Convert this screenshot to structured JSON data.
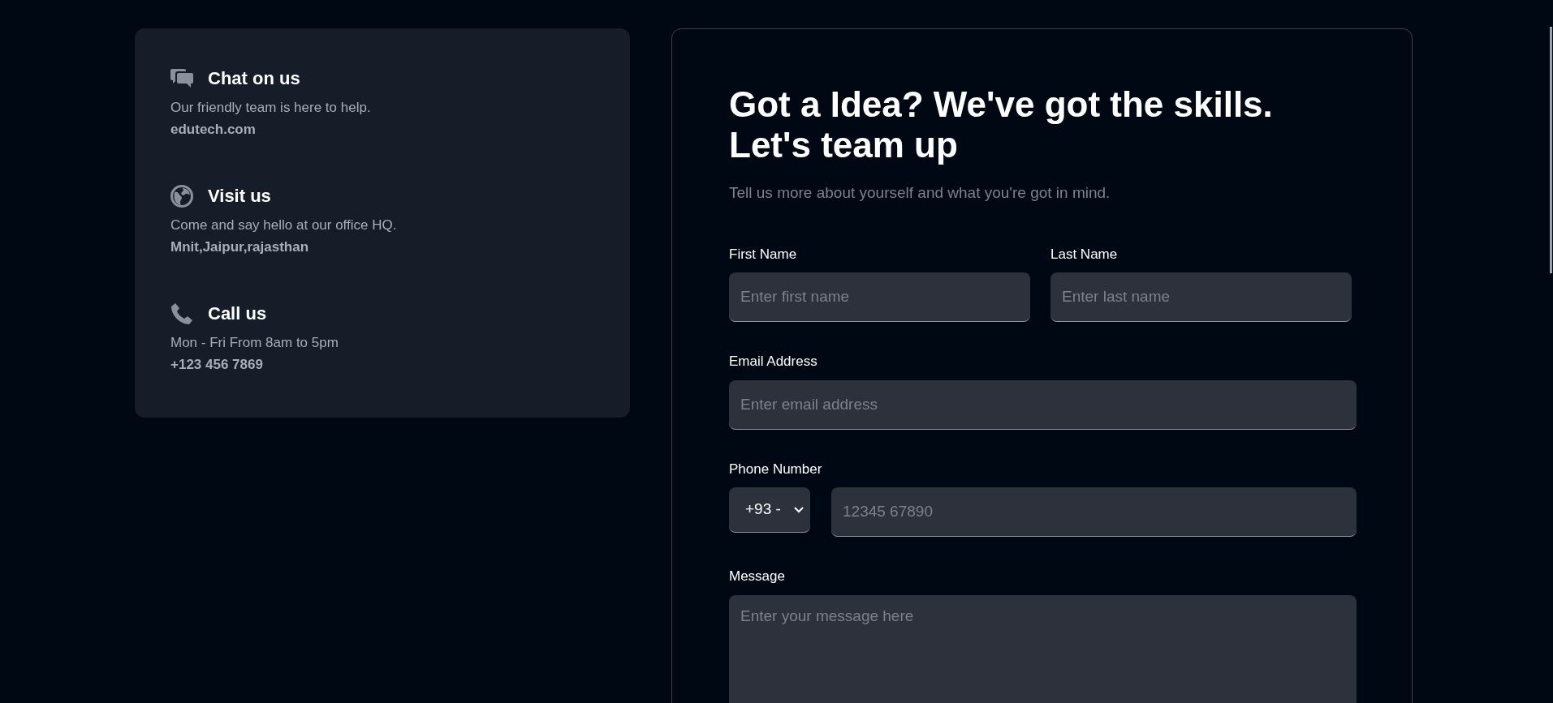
{
  "contacts": [
    {
      "kind": "chat",
      "title": "Chat on us",
      "description": "Our friendly team is here to help.",
      "detail": "edutech.com"
    },
    {
      "kind": "globe",
      "title": "Visit us",
      "description": "Come and say hello at our office HQ.",
      "detail": "Mnit,Jaipur,rajasthan"
    },
    {
      "kind": "phone",
      "title": "Call us",
      "description": "Mon - Fri From 8am to 5pm",
      "detail": "+123 456 7869"
    }
  ],
  "form": {
    "heading_lines": [
      "Got a Idea? We've got the skills.",
      "Let's team up"
    ],
    "subtitle": "Tell us more about yourself and what you're got in mind.",
    "first_name": {
      "label": "First Name",
      "placeholder": "Enter first name"
    },
    "last_name": {
      "label": "Last Name",
      "placeholder": "Enter last name"
    },
    "email": {
      "label": "Email Address",
      "placeholder": "Enter email address"
    },
    "phone": {
      "label": "Phone Number",
      "country_code": "+93 -",
      "placeholder": "12345 67890"
    },
    "message": {
      "label": "Message",
      "placeholder": "Enter your message here"
    }
  }
}
